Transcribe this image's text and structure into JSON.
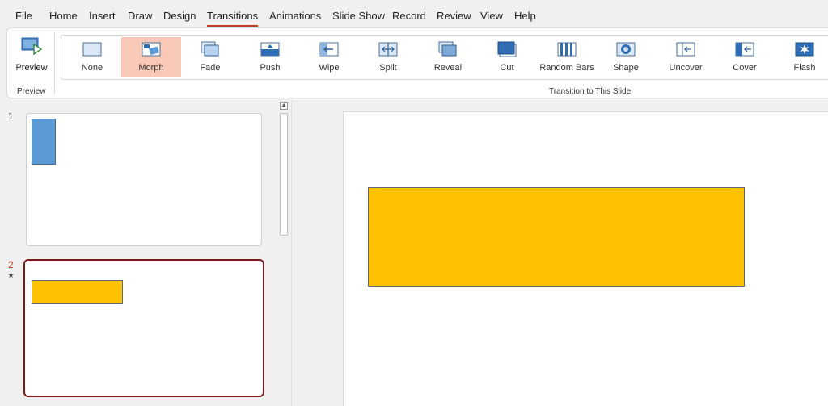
{
  "menu": {
    "tabs": [
      "File",
      "Home",
      "Insert",
      "Draw",
      "Design",
      "Transitions",
      "Animations",
      "Slide Show",
      "Record",
      "Review",
      "View",
      "Help"
    ],
    "active_tab": "Transitions"
  },
  "ribbon": {
    "preview_group": {
      "button_label": "Preview",
      "group_label": "Preview"
    },
    "transitions_group": {
      "group_label": "Transition to This Slide",
      "selected": "Morph",
      "items": [
        {
          "label": "None",
          "icon": "none-transition-icon"
        },
        {
          "label": "Morph",
          "icon": "morph-transition-icon"
        },
        {
          "label": "Fade",
          "icon": "fade-transition-icon"
        },
        {
          "label": "Push",
          "icon": "push-transition-icon"
        },
        {
          "label": "Wipe",
          "icon": "wipe-transition-icon"
        },
        {
          "label": "Split",
          "icon": "split-transition-icon"
        },
        {
          "label": "Reveal",
          "icon": "reveal-transition-icon"
        },
        {
          "label": "Cut",
          "icon": "cut-transition-icon"
        },
        {
          "label": "Random Bars",
          "icon": "random-bars-transition-icon"
        },
        {
          "label": "Shape",
          "icon": "shape-transition-icon"
        },
        {
          "label": "Uncover",
          "icon": "uncover-transition-icon"
        },
        {
          "label": "Cover",
          "icon": "cover-transition-icon"
        },
        {
          "label": "Flash",
          "icon": "flash-transition-icon"
        }
      ]
    }
  },
  "slides_pane": {
    "slides": [
      {
        "number": "1",
        "has_transition": false,
        "shape_color": "#5b9bd5"
      },
      {
        "number": "2",
        "has_transition": true,
        "transition_marker": "★",
        "shape_color": "#ffc000"
      }
    ],
    "selected_slide": "2"
  },
  "main_slide": {
    "shape_color": "#ffc000"
  },
  "colors": {
    "accent": "#c43e1c",
    "selected_transition_bg": "#f8c9b6",
    "selected_thumb_border": "#7a1a1a"
  }
}
